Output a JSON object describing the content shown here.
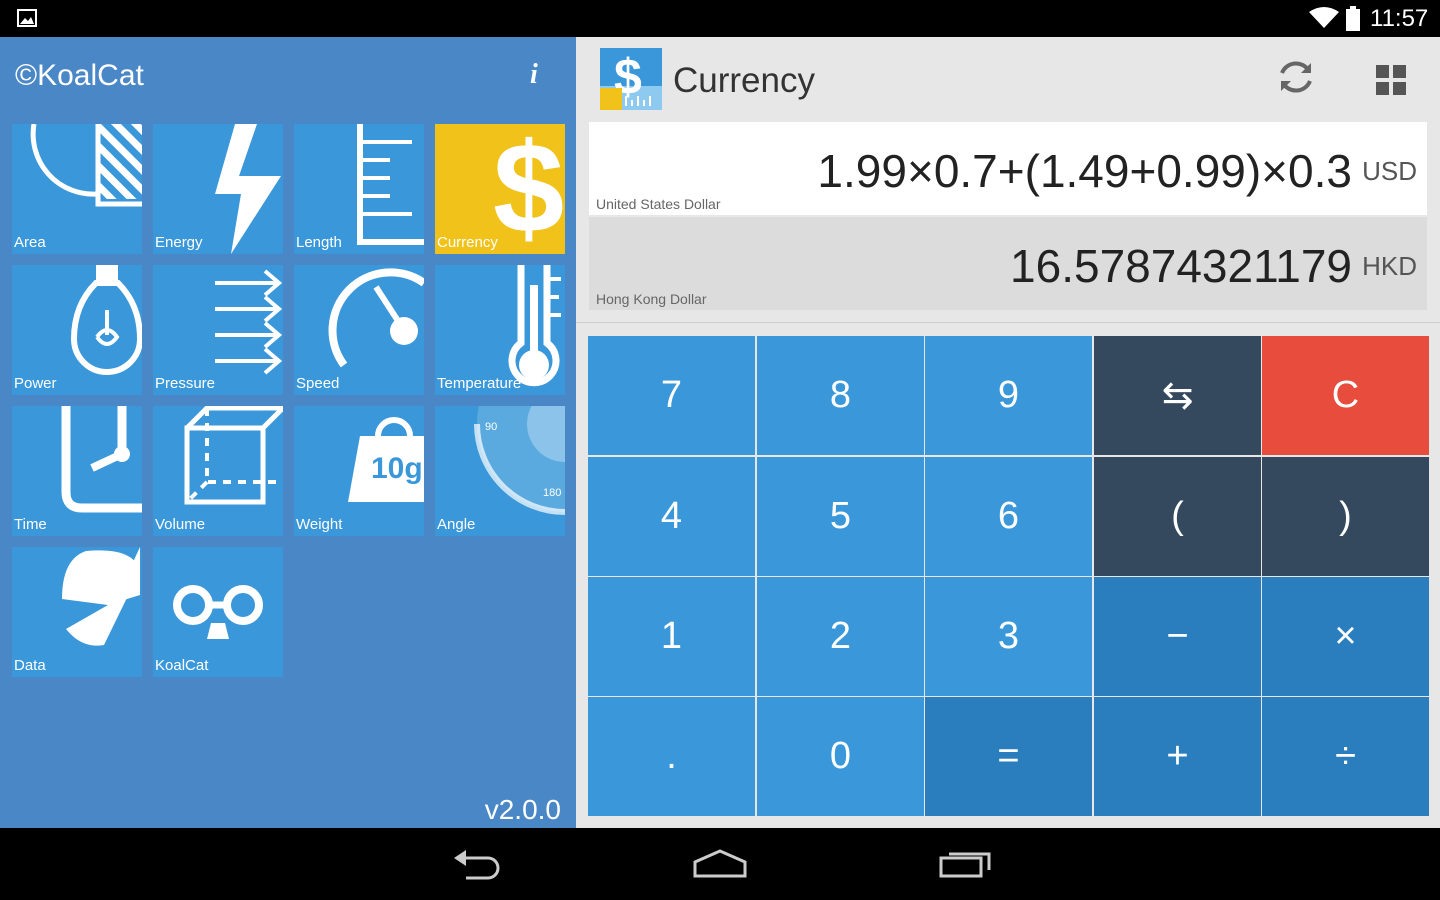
{
  "status": {
    "time": "11:57"
  },
  "sidebar": {
    "brand": "©KoalCat",
    "info_label": "i",
    "version": "v2.0.0",
    "tiles": [
      {
        "label": "Area",
        "icon": "area-icon",
        "active": false
      },
      {
        "label": "Energy",
        "icon": "lightning-icon",
        "active": false
      },
      {
        "label": "Length",
        "icon": "ruler-icon",
        "active": false
      },
      {
        "label": "Currency",
        "icon": "dollar-icon",
        "active": true
      },
      {
        "label": "Power",
        "icon": "lightbulb-icon",
        "active": false
      },
      {
        "label": "Pressure",
        "icon": "arrows-icon",
        "active": false
      },
      {
        "label": "Speed",
        "icon": "speedometer-icon",
        "active": false
      },
      {
        "label": "Temperature",
        "icon": "thermometer-icon",
        "active": false
      },
      {
        "label": "Time",
        "icon": "clock-icon",
        "active": false
      },
      {
        "label": "Volume",
        "icon": "cube-icon",
        "active": false
      },
      {
        "label": "Weight",
        "icon": "weight-icon",
        "active": false
      },
      {
        "label": "Angle",
        "icon": "protractor-icon",
        "active": false
      },
      {
        "label": "Data",
        "icon": "pie-icon",
        "active": false
      },
      {
        "label": "KoalCat",
        "icon": "koala-glasses-icon",
        "active": false
      }
    ]
  },
  "header": {
    "title": "Currency"
  },
  "icon_labels": {
    "weight": "10g",
    "angle_90": "90",
    "angle_180": "180"
  },
  "display": {
    "from": {
      "value": "1.99×0.7+(1.49+0.99)×0.3",
      "unit": "USD",
      "name": "United States Dollar"
    },
    "to": {
      "value": "16.57874321179",
      "unit": "HKD",
      "name": "Hong Kong Dollar"
    }
  },
  "keypad": {
    "k7": "7",
    "k8": "8",
    "k9": "9",
    "swap": "⇆",
    "clear": "C",
    "k4": "4",
    "k5": "5",
    "k6": "6",
    "lparen": "(",
    "rparen": ")",
    "k1": "1",
    "k2": "2",
    "k3": "3",
    "minus": "−",
    "times": "×",
    "dot": ".",
    "k0": "0",
    "equals": "=",
    "plus": "+",
    "divide": "÷"
  },
  "colors": {
    "sidebar_bg": "#4a87c7",
    "tile": "#3a98da",
    "tile_active": "#f1c21a",
    "key_blue": "#3a98da",
    "key_dark": "#34495e",
    "key_mid": "#2a7ebd",
    "key_clear": "#e74c3c"
  }
}
